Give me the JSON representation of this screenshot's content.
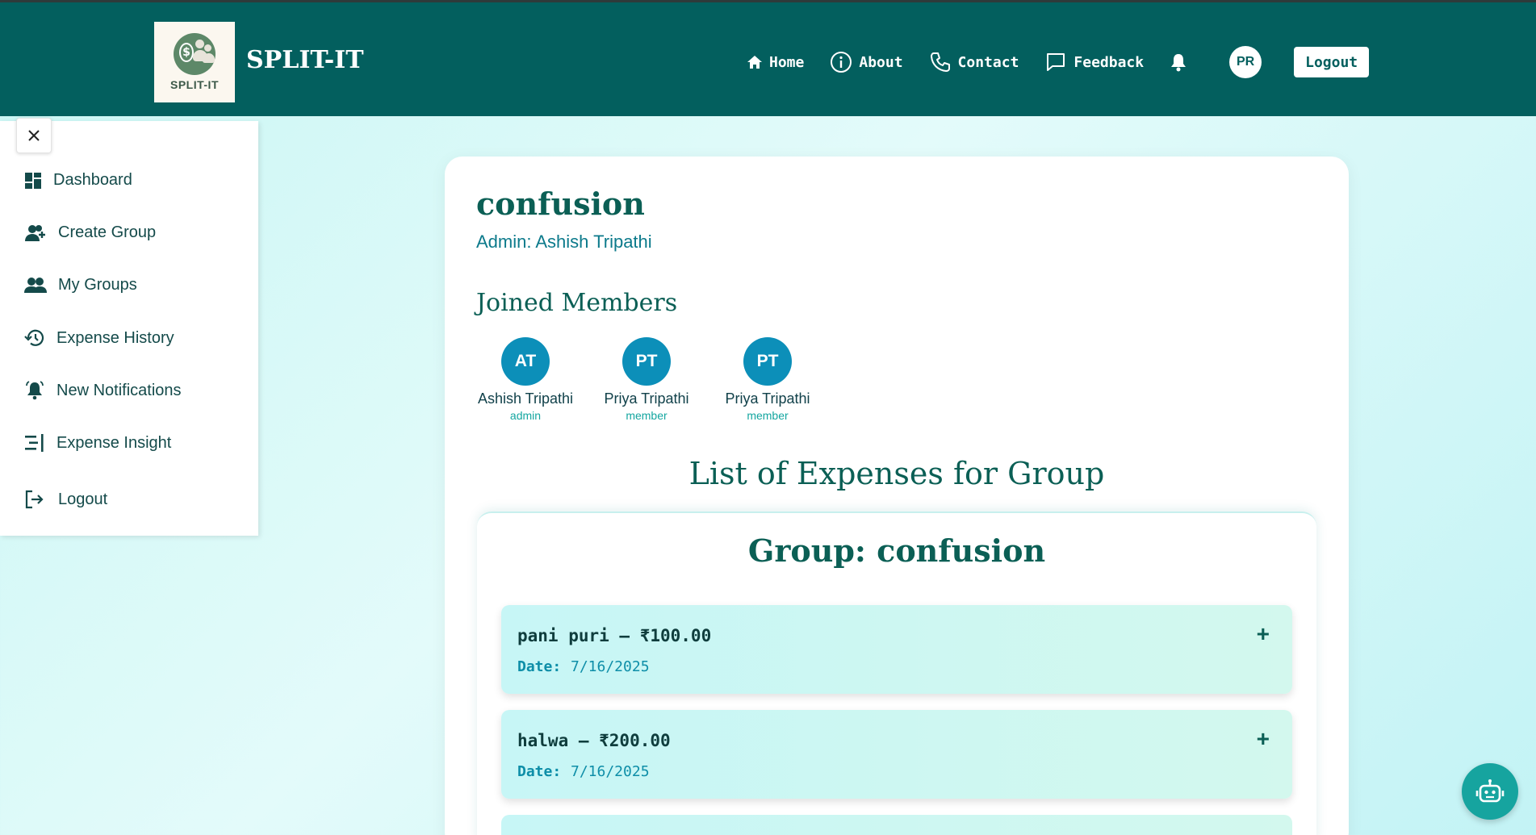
{
  "brand": {
    "logo_text": "SPLIT-IT",
    "name": "SPLIT-IT"
  },
  "nav": {
    "home": "Home",
    "about": "About",
    "contact": "Contact",
    "feedback": "Feedback",
    "avatar_initials": "PR",
    "logout": "Logout"
  },
  "sidebar": {
    "items": [
      {
        "label": "Dashboard",
        "icon": "dashboard-icon"
      },
      {
        "label": "Create Group",
        "icon": "add-user-icon"
      },
      {
        "label": "My Groups",
        "icon": "group-icon"
      },
      {
        "label": "Expense History",
        "icon": "history-icon"
      },
      {
        "label": "New Notifications",
        "icon": "bell-icon"
      },
      {
        "label": "Expense Insight",
        "icon": "insight-icon"
      },
      {
        "label": "Logout",
        "icon": "logout-icon"
      }
    ]
  },
  "group": {
    "title": "confusion",
    "admin": "Admin: Ashish Tripathi",
    "members_heading": "Joined Members",
    "members": [
      {
        "initials": "AT",
        "name": "Ashish Tripathi",
        "role": "admin"
      },
      {
        "initials": "PT",
        "name": "Priya Tripathi",
        "role": "member"
      },
      {
        "initials": "PT",
        "name": "Priya Tripathi",
        "role": "member"
      }
    ]
  },
  "expenses": {
    "heading": "List of Expenses for Group",
    "group_label": "Group: confusion",
    "date_label": "Date:",
    "items": [
      {
        "title": "pani puri – ₹100.00",
        "date": "7/16/2025"
      },
      {
        "title": "halwa – ₹200.00",
        "date": "7/16/2025"
      }
    ]
  },
  "colors": {
    "header": "#035f5e",
    "accent": "#0c8fb9",
    "primary_text": "#0b5f55"
  }
}
